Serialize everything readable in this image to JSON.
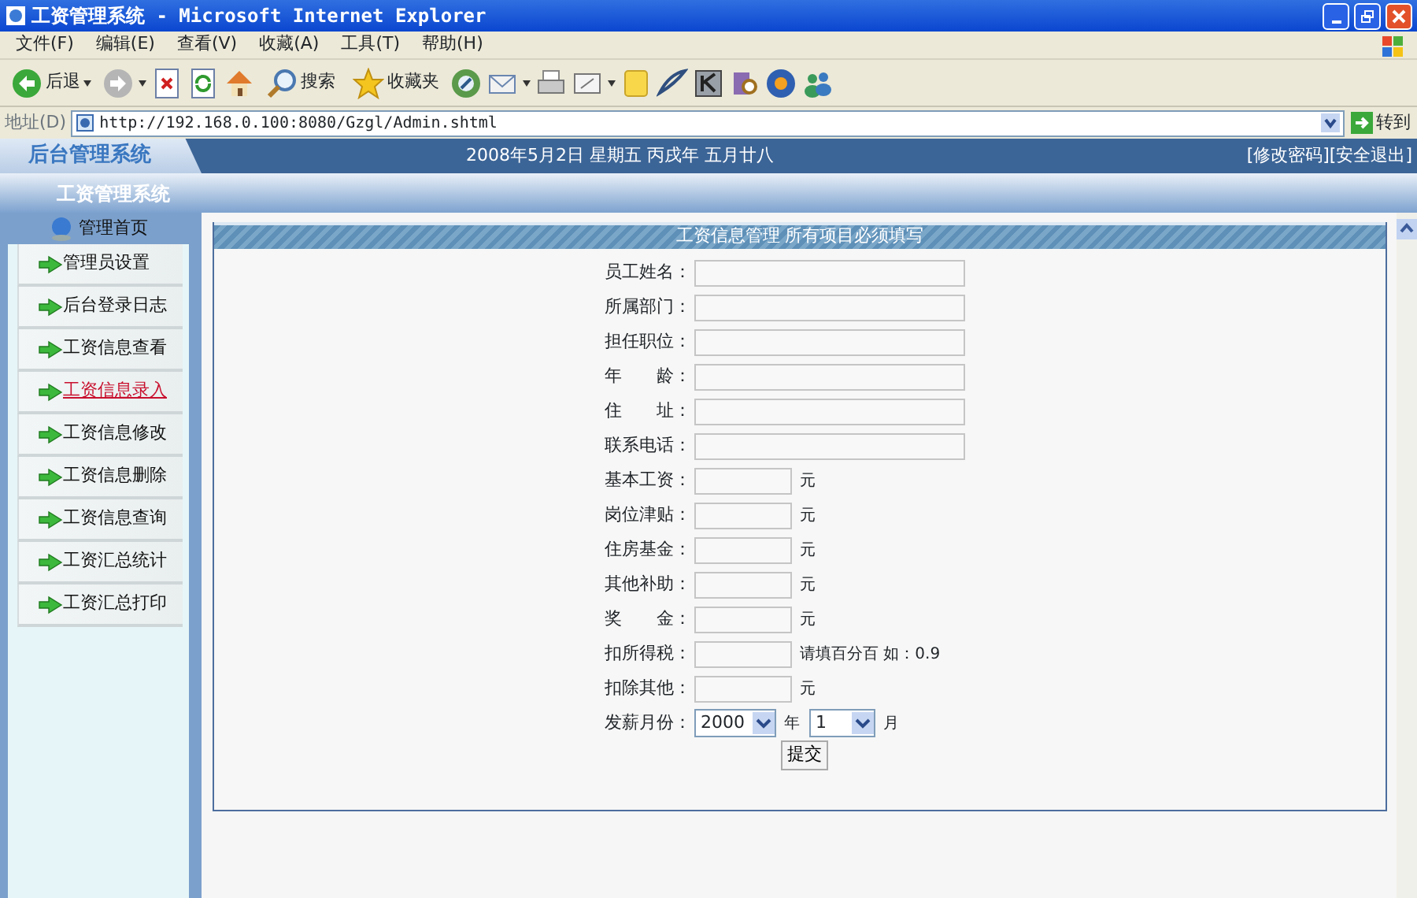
{
  "window": {
    "title": "工资管理系统 - Microsoft Internet Explorer"
  },
  "menu": [
    "文件(F)",
    "编辑(E)",
    "查看(V)",
    "收藏(A)",
    "工具(T)",
    "帮助(H)"
  ],
  "toolbar": [
    {
      "kind": "back",
      "label": "后退"
    },
    {
      "kind": "search",
      "label": "搜索"
    },
    {
      "kind": "favorites",
      "label": "收藏夹"
    }
  ],
  "address": {
    "label": "地址(D)",
    "url": "http://192.168.0.100:8080/Gzgl/Admin.shtml",
    "go": "转到"
  },
  "header": {
    "logo": "后台管理系统",
    "date": "2008年5月2日  星期五  丙戌年  五月廿八",
    "links": [
      "[修改密码]",
      "[安全退出]"
    ],
    "system": "工资管理系统"
  },
  "sidebar": {
    "heading": "管理首页",
    "items": [
      {
        "label": "管理员设置",
        "selected": false
      },
      {
        "label": "后台登录日志",
        "selected": false
      },
      {
        "label": "工资信息查看",
        "selected": false
      },
      {
        "label": "工资信息录入",
        "selected": true
      },
      {
        "label": "工资信息修改",
        "selected": false
      },
      {
        "label": "工资信息删除",
        "selected": false
      },
      {
        "label": "工资信息查询",
        "selected": false
      },
      {
        "label": "工资汇总统计",
        "selected": false
      },
      {
        "label": "工资汇总打印",
        "selected": false
      }
    ]
  },
  "form": {
    "title": "工资信息管理 所有项目必须填写",
    "fields": [
      {
        "kind": "wide",
        "label": "员工姓名："
      },
      {
        "kind": "wide",
        "label": "所属部门："
      },
      {
        "kind": "wide",
        "label": "担任职位："
      },
      {
        "kind": "wide",
        "label": "年　　龄："
      },
      {
        "kind": "wide",
        "label": "住　　址："
      },
      {
        "kind": "wide",
        "label": "联系电话："
      },
      {
        "kind": "short",
        "label": "基本工资：",
        "note": "元"
      },
      {
        "kind": "short",
        "label": "岗位津贴：",
        "note": "元"
      },
      {
        "kind": "short",
        "label": "住房基金：",
        "note": "元"
      },
      {
        "kind": "short",
        "label": "其他补助：",
        "note": "元"
      },
      {
        "kind": "short",
        "label": "奖　　金：",
        "note": "元"
      },
      {
        "kind": "short",
        "label": "扣所得税：",
        "note": "请填百分百  如：0.9"
      },
      {
        "kind": "short",
        "label": "扣除其他：",
        "note": "元"
      },
      {
        "kind": "date",
        "label": "发薪月份：",
        "year": "2000",
        "year_unit": "年",
        "month": "1",
        "month_unit": "月"
      }
    ],
    "submit": "提交"
  }
}
